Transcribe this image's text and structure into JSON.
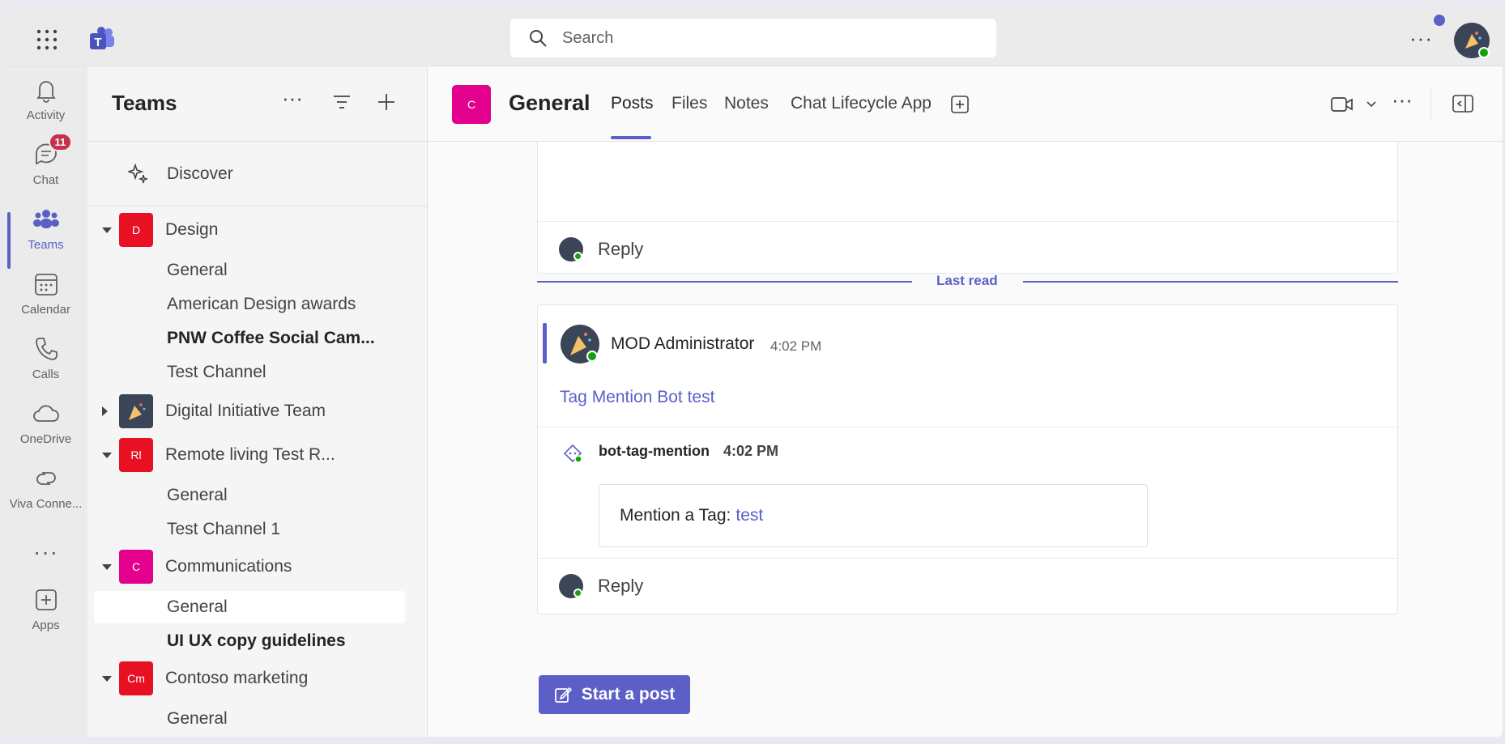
{
  "search": {
    "placeholder": "Search"
  },
  "rail": {
    "items": [
      {
        "label": "Activity"
      },
      {
        "label": "Chat",
        "badge": "11"
      },
      {
        "label": "Teams"
      },
      {
        "label": "Calendar"
      },
      {
        "label": "Calls"
      },
      {
        "label": "OneDrive"
      },
      {
        "label": "Viva Conne..."
      },
      {
        "label": "Apps"
      }
    ]
  },
  "panel": {
    "title": "Teams",
    "discover": "Discover",
    "teams": [
      {
        "name": "Design",
        "initials": "D",
        "color": "#e81123",
        "channels": [
          "General",
          "American Design awards",
          "PNW Coffee Social Cam...",
          "Test Channel"
        ]
      },
      {
        "name": "Digital Initiative Team",
        "initials": "",
        "color": "#3a4557",
        "channels": []
      },
      {
        "name": "Remote living Test R...",
        "initials": "Rl",
        "color": "#e81123",
        "channels": [
          "General",
          "Test Channel 1"
        ]
      },
      {
        "name": "Communications",
        "initials": "C",
        "color": "#e3008c",
        "channels": [
          "General",
          "UI UX copy guidelines"
        ]
      },
      {
        "name": "Contoso marketing",
        "initials": "Cm",
        "color": "#e81123",
        "channels": [
          "General"
        ]
      }
    ]
  },
  "channel_header": {
    "initials": "C",
    "title": "General",
    "tabs": [
      "Posts",
      "Files",
      "Notes",
      "Chat Lifecycle App"
    ]
  },
  "messages": {
    "reply_label": "Reply",
    "last_read": "Last read",
    "post": {
      "author": "MOD Administrator",
      "time": "4:02 PM",
      "text": "Tag Mention Bot test"
    },
    "bot_reply": {
      "author": "bot-tag-mention",
      "time": "4:02 PM",
      "card_text": "Mention a Tag:",
      "card_tag": "test"
    },
    "start_post": "Start a post"
  },
  "colors": {
    "accent": "#5b5fc7",
    "presence": "#13a10e",
    "badge": "#c4314b"
  }
}
